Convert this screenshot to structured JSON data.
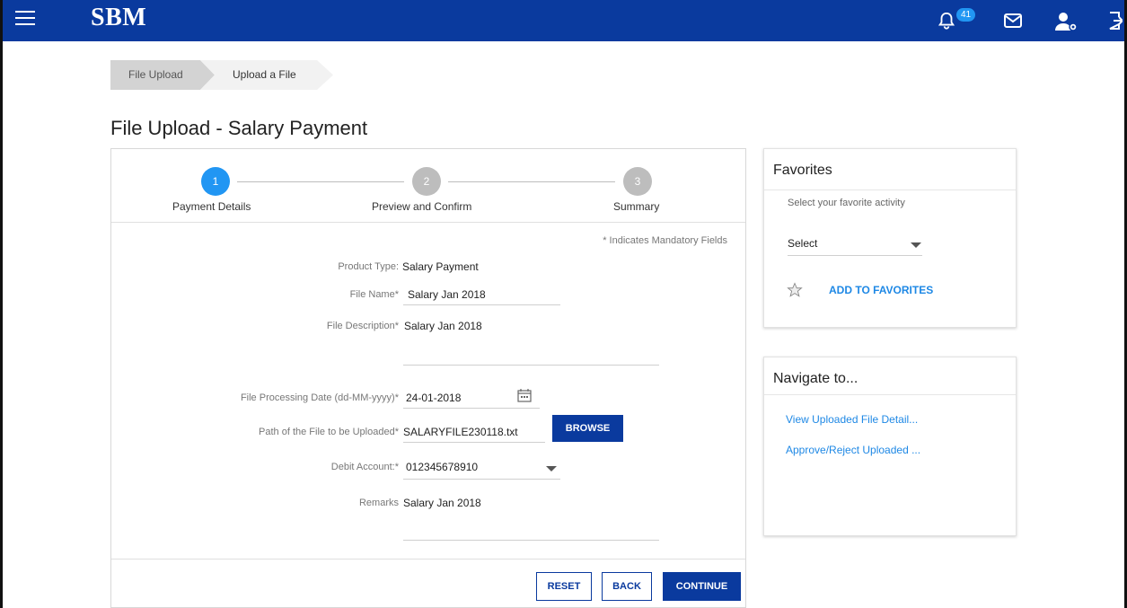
{
  "app": {
    "brand": "SBM",
    "notification_count": "41"
  },
  "breadcrumb": [
    "File Upload",
    "Upload a File"
  ],
  "page_title": "File Upload - Salary Payment",
  "stepper": {
    "steps": [
      {
        "number": "1",
        "label": "Payment Details",
        "state": "active"
      },
      {
        "number": "2",
        "label": "Preview and Confirm",
        "state": "inactive"
      },
      {
        "number": "3",
        "label": "Summary",
        "state": "inactive"
      }
    ]
  },
  "form": {
    "mandatory_note": "* Indicates Mandatory Fields",
    "product_type": {
      "label": "Product Type:",
      "value": "Salary Payment"
    },
    "file_name": {
      "label": "File Name*",
      "value": "Salary  Jan 2018"
    },
    "file_description": {
      "label": "File Description*",
      "value": "Salary Jan  2018"
    },
    "processing_date": {
      "label": "File Processing Date (dd-MM-yyyy)*",
      "value": "24-01-2018"
    },
    "file_path": {
      "label": "Path of the File to be Uploaded*",
      "value": "SALARYFILE230118.txt"
    },
    "browse_label": "BROWSE",
    "debit_account": {
      "label": "Debit Account:*",
      "value": "012345678910"
    },
    "remarks": {
      "label": "Remarks",
      "value": "Salary Jan 2018"
    }
  },
  "actions": {
    "reset": "RESET",
    "back": "BACK",
    "continue": "CONTINUE"
  },
  "favorites": {
    "title": "Favorites",
    "subtitle": "Select your favorite activity",
    "select_value": "Select",
    "add_label": "ADD TO FAVORITES"
  },
  "navigate": {
    "title": "Navigate to...",
    "links": [
      "View Uploaded File Detail...",
      "Approve/Reject Uploaded ..."
    ]
  },
  "colors": {
    "brand_blue": "#0a3a9e",
    "step_active": "#2196f3",
    "step_inactive": "#bdbdbd",
    "link_blue": "#1e88e5"
  }
}
